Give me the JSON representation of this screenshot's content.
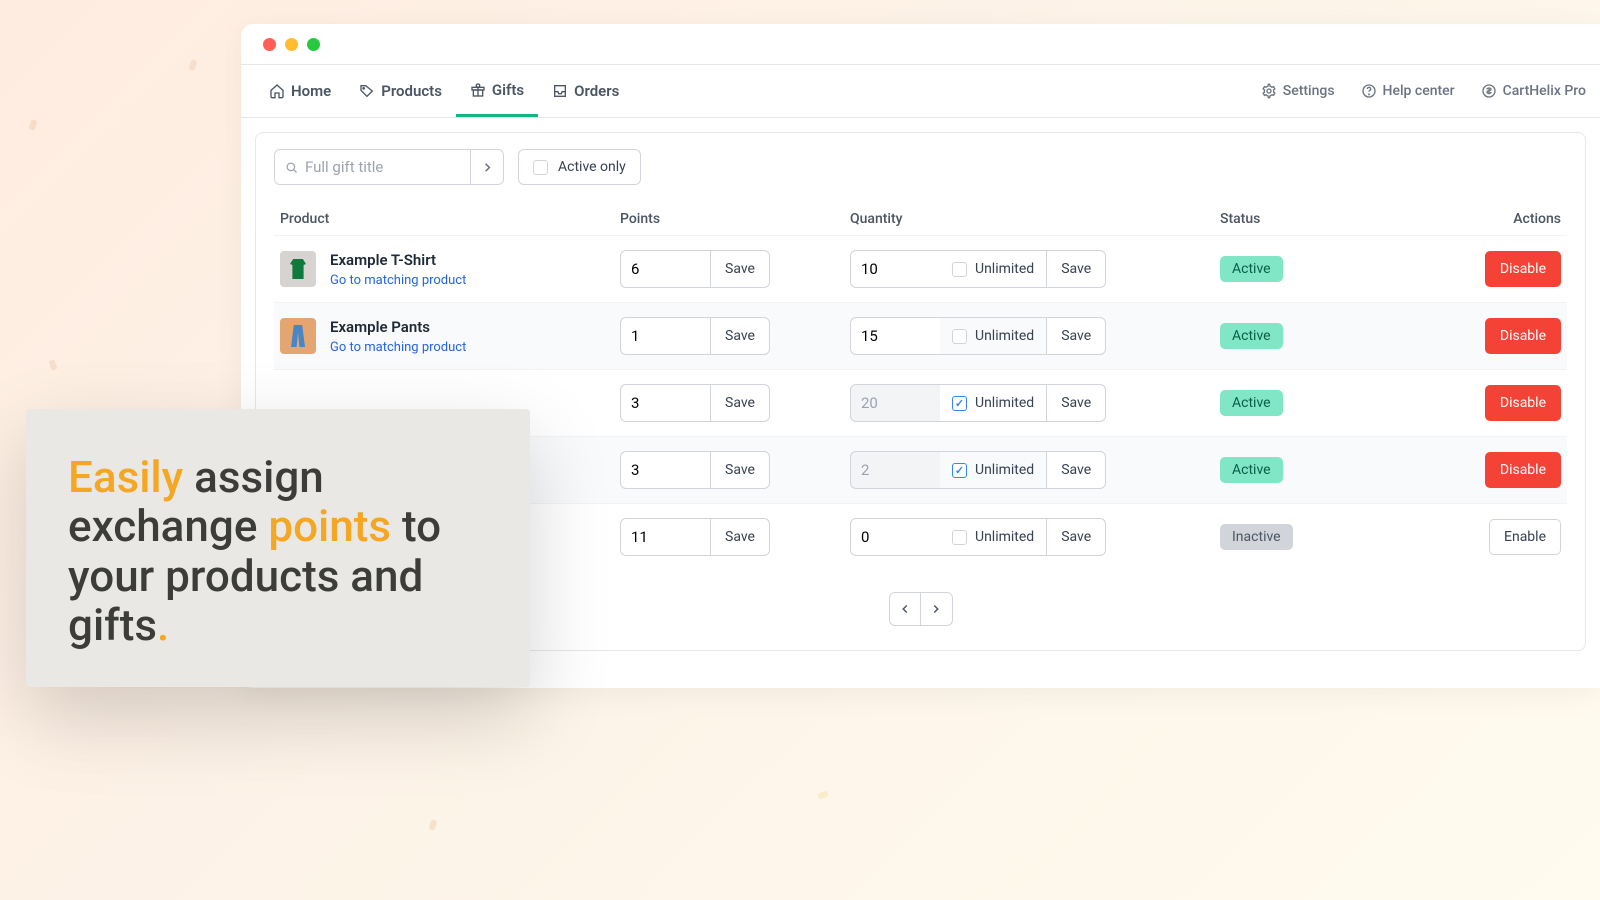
{
  "nav": {
    "home": "Home",
    "products": "Products",
    "gifts": "Gifts",
    "orders": "Orders",
    "settings": "Settings",
    "help": "Help center",
    "pro": "CartHelix Pro"
  },
  "filters": {
    "search_placeholder": "Full gift title",
    "active_only": "Active only"
  },
  "columns": {
    "product": "Product",
    "points": "Points",
    "quantity": "Quantity",
    "status": "Status",
    "actions": "Actions"
  },
  "labels": {
    "save": "Save",
    "unlimited": "Unlimited",
    "go_to_product": "Go to matching product",
    "disable": "Disable",
    "enable": "Enable",
    "active": "Active",
    "inactive": "Inactive"
  },
  "rows": [
    {
      "name": "Example T-Shirt",
      "thumb": "shirt",
      "points": "6",
      "qty": "10",
      "unlimited": false,
      "status": "active"
    },
    {
      "name": "Example Pants",
      "thumb": "pants",
      "points": "1",
      "qty": "15",
      "unlimited": false,
      "status": "active"
    },
    {
      "name": "",
      "thumb": "",
      "points": "3",
      "qty": "20",
      "unlimited": true,
      "status": "active"
    },
    {
      "name": "",
      "thumb": "",
      "points": "3",
      "qty": "2",
      "unlimited": true,
      "status": "active"
    },
    {
      "name": "",
      "thumb": "",
      "points": "11",
      "qty": "0",
      "unlimited": false,
      "status": "inactive"
    }
  ],
  "callout": {
    "w1": "Easily",
    "t1": " assign exchange ",
    "w2": "points",
    "t2": " to your products and gifts",
    "dot": "."
  }
}
